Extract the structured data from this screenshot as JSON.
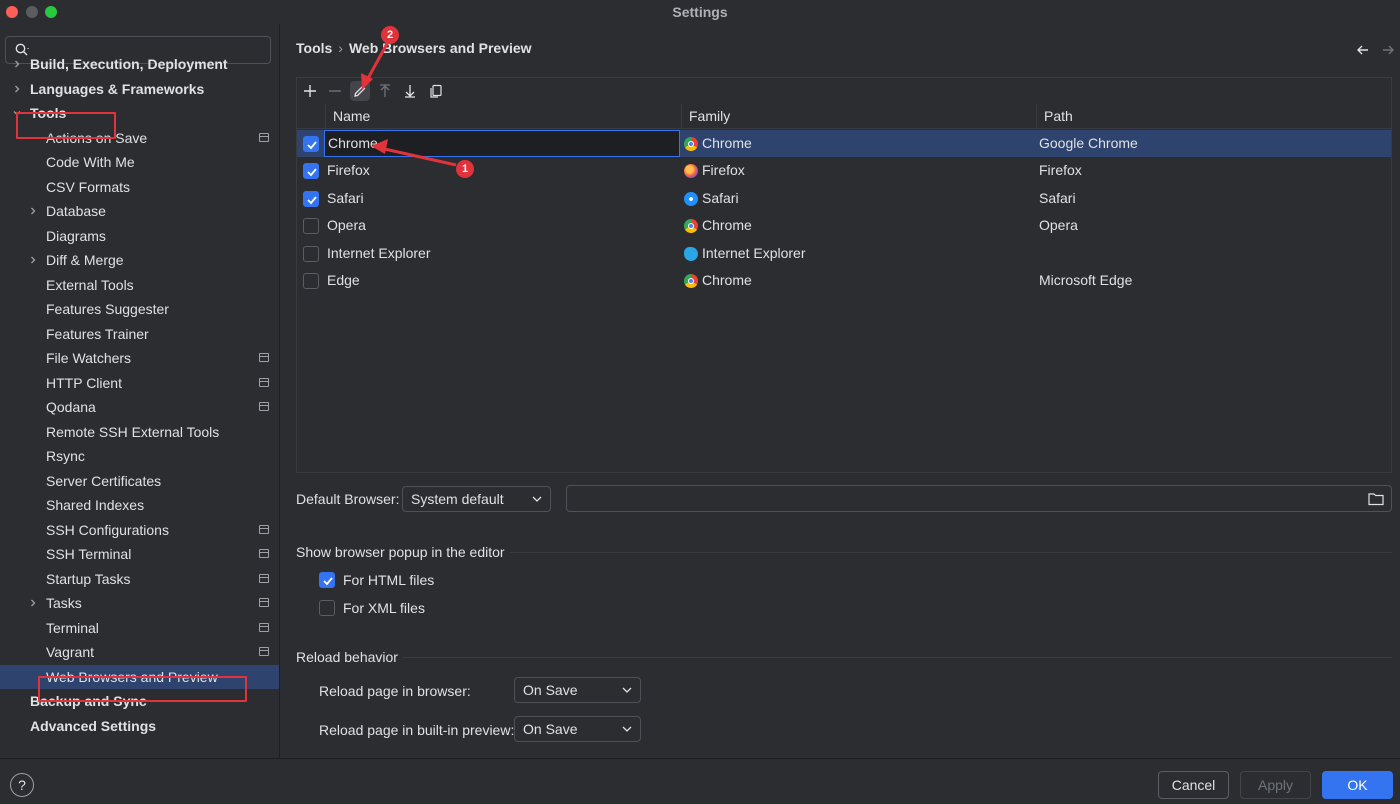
{
  "window": {
    "title": "Settings"
  },
  "search": {
    "placeholder": ""
  },
  "sidebar": {
    "items": [
      {
        "label": "Build, Execution, Deployment",
        "bold": true,
        "chevron": "right"
      },
      {
        "label": "Languages & Frameworks",
        "bold": true,
        "chevron": "right"
      },
      {
        "label": "Tools",
        "bold": true,
        "chevron": "down"
      },
      {
        "label": "Actions on Save",
        "project": true
      },
      {
        "label": "Code With Me"
      },
      {
        "label": "CSV Formats"
      },
      {
        "label": "Database",
        "chevron": "right"
      },
      {
        "label": "Diagrams"
      },
      {
        "label": "Diff & Merge",
        "chevron": "right"
      },
      {
        "label": "External Tools"
      },
      {
        "label": "Features Suggester"
      },
      {
        "label": "Features Trainer"
      },
      {
        "label": "File Watchers",
        "project": true
      },
      {
        "label": "HTTP Client",
        "project": true
      },
      {
        "label": "Qodana",
        "project": true
      },
      {
        "label": "Remote SSH External Tools"
      },
      {
        "label": "Rsync"
      },
      {
        "label": "Server Certificates"
      },
      {
        "label": "Shared Indexes"
      },
      {
        "label": "SSH Configurations",
        "project": true
      },
      {
        "label": "SSH Terminal",
        "project": true
      },
      {
        "label": "Startup Tasks",
        "project": true
      },
      {
        "label": "Tasks",
        "chevron": "right",
        "project": true
      },
      {
        "label": "Terminal",
        "project": true
      },
      {
        "label": "Vagrant",
        "project": true
      },
      {
        "label": "Web Browsers and Preview",
        "selected": true
      },
      {
        "label": "Backup and Sync",
        "bold": true
      },
      {
        "label": "Advanced Settings",
        "bold": true
      }
    ]
  },
  "breadcrumb": {
    "parent": "Tools",
    "separator": "›",
    "current": "Web Browsers and Preview"
  },
  "toolbar": {
    "icons": [
      "add-icon",
      "remove-icon",
      "edit-icon",
      "move-up-icon",
      "move-down-icon",
      "copy-icon"
    ]
  },
  "browsers": {
    "columns": [
      "Name",
      "Family",
      "Path"
    ],
    "rows": [
      {
        "checked": true,
        "name": "Chrome",
        "family": "Chrome",
        "path": "Google Chrome",
        "selected": true,
        "editing": true
      },
      {
        "checked": true,
        "name": "Firefox",
        "family": "Firefox",
        "path": "Firefox"
      },
      {
        "checked": true,
        "name": "Safari",
        "family": "Safari",
        "path": "Safari"
      },
      {
        "checked": false,
        "name": "Opera",
        "family": "Chrome",
        "path": "Opera"
      },
      {
        "checked": false,
        "name": "Internet Explorer",
        "family": "Internet Explorer",
        "path": ""
      },
      {
        "checked": false,
        "name": "Edge",
        "family": "Chrome",
        "path": "Microsoft Edge"
      }
    ]
  },
  "default_browser": {
    "label": "Default Browser:",
    "value": "System default",
    "path": ""
  },
  "popup": {
    "title": "Show browser popup in the editor",
    "html": {
      "label": "For HTML files",
      "checked": true
    },
    "xml": {
      "label": "For XML files",
      "checked": false
    }
  },
  "reload": {
    "title": "Reload behavior",
    "browser_label": "Reload page in browser:",
    "browser_value": "On Save",
    "preview_label": "Reload page in built-in preview:",
    "preview_value": "On Save"
  },
  "buttons": {
    "help": "?",
    "cancel": "Cancel",
    "apply": "Apply",
    "ok": "OK"
  },
  "annotations": {
    "badge1": "1",
    "badge2": "2"
  },
  "colors": {
    "accent": "#3574f0",
    "selection": "#2e436e",
    "annotation": "#e0333b"
  }
}
